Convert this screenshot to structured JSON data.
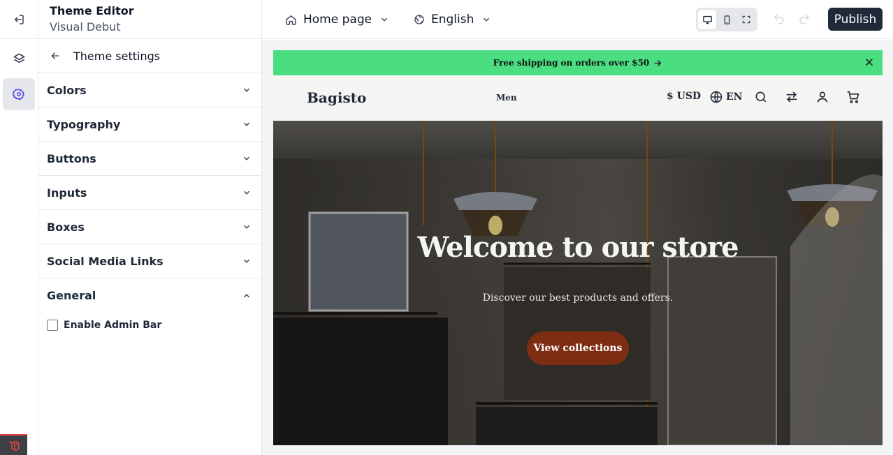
{
  "app": {
    "title": "Theme Editor",
    "theme_name": "Visual Debut"
  },
  "toolbar": {
    "page_selector": "Home page",
    "language_selector": "English",
    "publish_label": "Publish",
    "active_device": "desktop"
  },
  "panel": {
    "title": "Theme settings",
    "sections": [
      {
        "label": "Colors",
        "expanded": false
      },
      {
        "label": "Typography",
        "expanded": false
      },
      {
        "label": "Buttons",
        "expanded": false
      },
      {
        "label": "Inputs",
        "expanded": false
      },
      {
        "label": "Boxes",
        "expanded": false
      },
      {
        "label": "Social Media Links",
        "expanded": false
      },
      {
        "label": "General",
        "expanded": true
      }
    ],
    "general": {
      "enable_admin_bar_label": "Enable Admin Bar",
      "enable_admin_bar_checked": false
    }
  },
  "preview": {
    "announcement": "Free shipping on orders over $50",
    "logo": "Bagisto",
    "nav_item": "Men",
    "currency": "$ USD",
    "language": "EN",
    "hero_title": "Welcome to our store",
    "hero_subtitle": "Discover our best products and offers.",
    "hero_button": "View collections"
  },
  "colors": {
    "accent_dark": "#1f2937",
    "announcement_bg": "#4ade80",
    "hero_button_bg": "#7c2d12",
    "active_rail_bg": "#e5e7eb",
    "active_rail_icon": "#4f46e5"
  },
  "icons": [
    "exit-icon",
    "home-icon",
    "globe-icon",
    "chevron-down-icon",
    "desktop-icon",
    "mobile-icon",
    "fullscreen-icon",
    "undo-icon",
    "redo-icon",
    "layers-icon",
    "settings-icon",
    "laravel-icon",
    "back-arrow-icon",
    "chevron-up-icon",
    "arrow-right-icon",
    "close-icon",
    "search-icon",
    "compare-icon",
    "user-icon",
    "cart-icon"
  ]
}
